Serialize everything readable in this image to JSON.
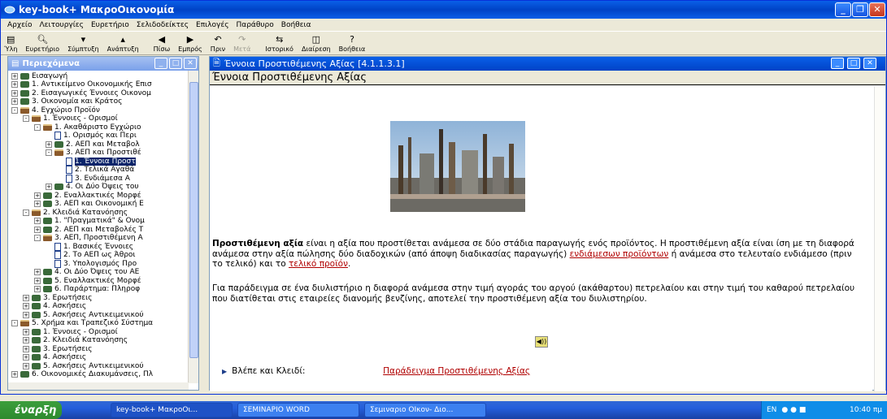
{
  "window": {
    "title": "key-book+  ΜακροΟικονομία"
  },
  "menu": [
    "Αρχείο",
    "Λειτουργίες",
    "Ευρετήριο",
    "Σελιδοδείκτες",
    "Επιλογές",
    "Παράθυρο",
    "Βοήθεια"
  ],
  "toolbar": [
    {
      "label": "Ύλη",
      "icon": "contents-icon",
      "enabled": true
    },
    {
      "label": "Ευρετήριο",
      "icon": "magnifier-icon",
      "enabled": true
    },
    {
      "label": "Σύμπτυξη",
      "icon": "collapse-icon",
      "enabled": true
    },
    {
      "label": "Ανάπτυξη",
      "icon": "expand-icon",
      "enabled": true
    },
    {
      "label": "Πίσω",
      "icon": "back-arrow-icon",
      "enabled": true
    },
    {
      "label": "Εμπρός",
      "icon": "forward-arrow-icon",
      "enabled": true
    },
    {
      "label": "Πριν",
      "icon": "undo-icon",
      "enabled": true
    },
    {
      "label": "Μετά",
      "icon": "redo-icon",
      "enabled": false
    },
    {
      "label": "Ιστορικό",
      "icon": "history-icon",
      "enabled": true
    },
    {
      "label": "Διαίρεση",
      "icon": "split-icon",
      "enabled": true
    },
    {
      "label": "Βοήθεια",
      "icon": "help-icon",
      "enabled": true
    }
  ],
  "left_pane": {
    "title": "Περιεχόμενα",
    "tree": [
      {
        "level": 0,
        "label": "Εισαγωγή",
        "icon": "book-icon",
        "exp": "+"
      },
      {
        "level": 0,
        "label": "1. Αντικείμενο Οικονομικής Επισ",
        "icon": "book-icon",
        "exp": "+"
      },
      {
        "level": 0,
        "label": "2. Εισαγωγικές Έννοιες Οικονομ",
        "icon": "book-icon",
        "exp": "+"
      },
      {
        "level": 0,
        "label": "3. Οικονομία και Κράτος",
        "icon": "book-icon",
        "exp": "+"
      },
      {
        "level": 0,
        "label": "4. Εγχώριο Προϊόν",
        "icon": "open-book-icon",
        "exp": "-"
      },
      {
        "level": 1,
        "label": "1. Έννοιες - Ορισμοί",
        "icon": "open-book-icon",
        "exp": "-"
      },
      {
        "level": 2,
        "label": "1. Ακαθάριστο Εγχώριο",
        "icon": "open-book-icon",
        "exp": "-"
      },
      {
        "level": 3,
        "label": "1. Ορισμός και Περι",
        "icon": "page-icon",
        "exp": ""
      },
      {
        "level": 3,
        "label": "2. ΑΕΠ και Μεταβολ",
        "icon": "book-icon",
        "exp": "+"
      },
      {
        "level": 3,
        "label": "3. ΑΕΠ και Προστιθέ",
        "icon": "open-book-icon",
        "exp": "-"
      },
      {
        "level": 4,
        "label": "1. Έννοια Προστ",
        "icon": "page-icon",
        "exp": "",
        "selected": true
      },
      {
        "level": 4,
        "label": "2. Τελικά Αγαθά",
        "icon": "page-icon",
        "exp": ""
      },
      {
        "level": 4,
        "label": "3. Ενδιάμεσα Α",
        "icon": "page-icon",
        "exp": ""
      },
      {
        "level": 3,
        "label": "4. Οι Δύο Όψεις του",
        "icon": "book-icon",
        "exp": "+"
      },
      {
        "level": 2,
        "label": "2. Εναλλακτικές Μορφέ",
        "icon": "book-icon",
        "exp": "+"
      },
      {
        "level": 2,
        "label": "3. ΑΕΠ και Οικονομική Ε",
        "icon": "book-icon",
        "exp": "+"
      },
      {
        "level": 1,
        "label": "2. Κλειδιά Κατανόησης",
        "icon": "open-book-icon",
        "exp": "-"
      },
      {
        "level": 2,
        "label": "1. \"Πραγματικά\" & Ονομ",
        "icon": "book-icon",
        "exp": "+"
      },
      {
        "level": 2,
        "label": "2. ΑΕΠ και Μεταβολές Τ",
        "icon": "book-icon",
        "exp": "+"
      },
      {
        "level": 2,
        "label": "3. ΑΕΠ, Προστιθέμενη Α",
        "icon": "open-book-icon",
        "exp": "-"
      },
      {
        "level": 3,
        "label": "1. Βασικές Έννοιες",
        "icon": "page-icon",
        "exp": ""
      },
      {
        "level": 3,
        "label": "2. Το ΑΕΠ ως Άθροι",
        "icon": "page-icon",
        "exp": ""
      },
      {
        "level": 3,
        "label": "3. Υπολογισμός Προ",
        "icon": "page-icon",
        "exp": ""
      },
      {
        "level": 2,
        "label": "4. Οι Δύο Όψεις του ΑΕ",
        "icon": "book-icon",
        "exp": "+"
      },
      {
        "level": 2,
        "label": "5. Εναλλακτικές Μορφέ",
        "icon": "book-icon",
        "exp": "+"
      },
      {
        "level": 2,
        "label": "6. Παράρτημα: Πληροφ",
        "icon": "book-icon",
        "exp": "+"
      },
      {
        "level": 1,
        "label": "3. Ερωτήσεις",
        "icon": "book-icon",
        "exp": "+"
      },
      {
        "level": 1,
        "label": "4. Ασκήσεις",
        "icon": "book-icon",
        "exp": "+"
      },
      {
        "level": 1,
        "label": "5. Ασκήσεις Αντικειμενικού",
        "icon": "book-icon",
        "exp": "+"
      },
      {
        "level": 0,
        "label": "5. Χρήμα και Τραπεζικό Σύστημα",
        "icon": "open-book-icon",
        "exp": "-"
      },
      {
        "level": 1,
        "label": "1. Έννοιες - Ορισμοί",
        "icon": "book-icon",
        "exp": "+"
      },
      {
        "level": 1,
        "label": "2. Κλειδιά Κατανόησης",
        "icon": "book-icon",
        "exp": "+"
      },
      {
        "level": 1,
        "label": "3. Ερωτήσεις",
        "icon": "book-icon",
        "exp": "+"
      },
      {
        "level": 1,
        "label": "4. Ασκήσεις",
        "icon": "book-icon",
        "exp": "+"
      },
      {
        "level": 1,
        "label": "5. Ασκήσεις Αντικειμενικού",
        "icon": "book-icon",
        "exp": "+"
      },
      {
        "level": 0,
        "label": "6. Οικονομικές Διακυμάνσεις, Πλ",
        "icon": "book-icon",
        "exp": "+"
      }
    ]
  },
  "right_pane": {
    "title": "Έννοια Προστιθέμενης Αξίας   [4.1.1.3.1]",
    "heading": "Έννοια Προστιθέμενης Αξίας",
    "p1_bold": "Προστιθέμενη αξία",
    "p1_text1": " είναι η αξία που προστίθεται ανάμεσα σε δύο στάδια παραγωγής ενός προϊόντος. Η προστιθέμενη αξία είναι ίση με τη διαφορά ανάμεσα στην αξία πώλησης δύο διαδοχικών (από άποψη διαδικασίας παραγωγής) ",
    "p1_link1": "ενδιάμεσων προϊόντων",
    "p1_text2": " ή ανάμεσα στο τελευταίο ενδιάμεσο (πριν το τελικό) και το ",
    "p1_link2": "τελικό προϊόν",
    "p1_text3": ".",
    "p2": "Για παράδειγμα σε ένα διυλιστήριο η διαφορά ανάμεσα στην τιμή αγοράς του αργού (ακάθαρτου) πετρελαίου και στην τιμή του καθαρού πετρελαίου που διατίθεται στις εταιρείες διανομής βενζίνης, αποτελεί την προστιθέμενη αξία του διυλιστηρίου.",
    "see_also_label": "Βλέπε και Κλειδί:",
    "see_also_link": "Παράδειγμα Προστιθέμενης Αξίας"
  },
  "taskbar": {
    "start": "έναρξη",
    "tasks": [
      "key-book+  ΜακροΟι...",
      "ΣΕΜΙΝΑΡΙΟ WORD",
      "Σεμιναριο ΟΙκον- Διο..."
    ],
    "lang": "EN",
    "clock": "10:40 πμ"
  }
}
